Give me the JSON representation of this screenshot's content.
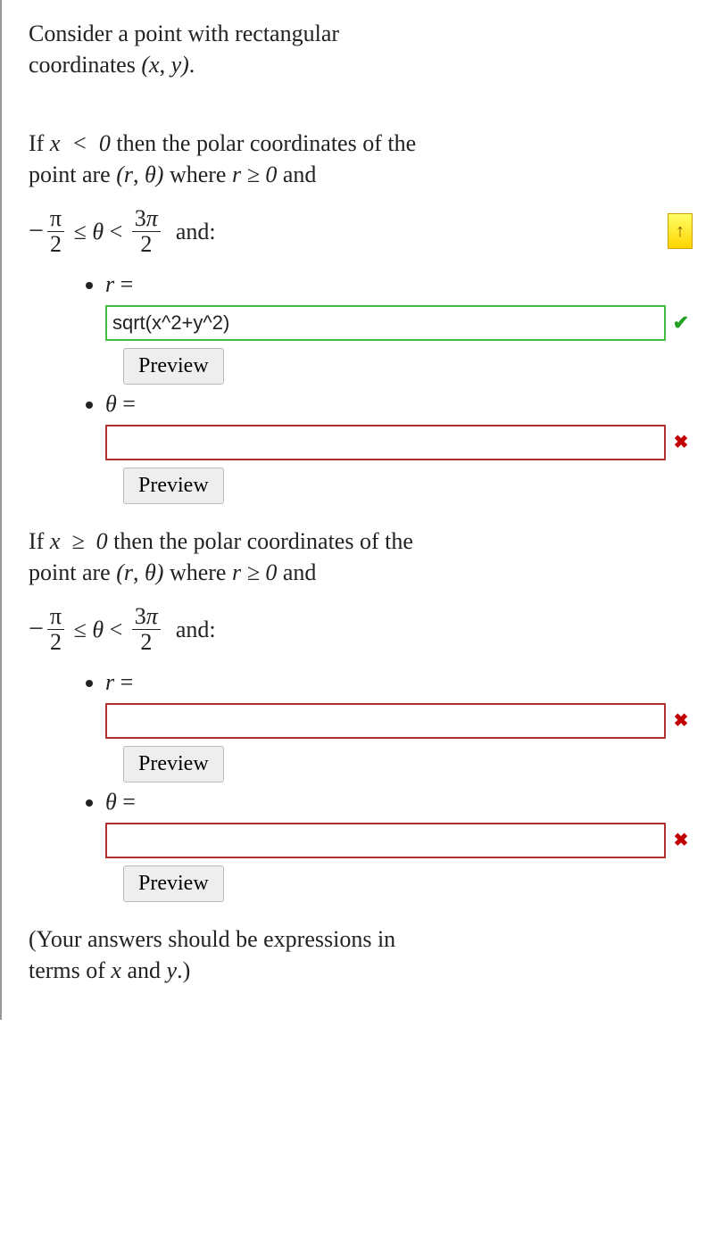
{
  "problem": {
    "intro_line1": "Consider a point with rectangular",
    "intro_line2_prefix": "coordinates ",
    "intro_line2_math": "(x, y)",
    "intro_line2_suffix": ".",
    "case_a": {
      "line1_prefix": "If ",
      "line1_cond_var": "x",
      "line1_cond_op": "<",
      "line1_cond_rhs": "0",
      "line1_mid": " then the polar coordinates of the",
      "line2_prefix": "point are ",
      "line2_rtheta": "(r, θ)",
      "line2_mid": " where ",
      "line2_r": "r",
      "line2_ge": "≥",
      "line2_zero": "0",
      "line2_and": " and",
      "range_minus": "−",
      "range_pi": "π",
      "range_two": "2",
      "range_le": "≤",
      "range_theta": "θ",
      "range_lt": "<",
      "range_3pi": "3π",
      "range_two_b": "2",
      "range_and": "and:"
    },
    "case_b": {
      "line1_prefix": "If ",
      "line1_cond_var": "x",
      "line1_cond_op": "≥",
      "line1_cond_rhs": "0",
      "line1_mid": " then the polar coordinates of the",
      "line2_prefix": "point are ",
      "line2_rtheta": "(r, θ)",
      "line2_mid": " where ",
      "line2_r": "r",
      "line2_ge": "≥",
      "line2_zero": "0",
      "line2_and": " and",
      "range_minus": "−",
      "range_pi": "π",
      "range_two": "2",
      "range_le": "≤",
      "range_theta": "θ",
      "range_lt": "<",
      "range_3pi": "3π",
      "range_two_b": "2",
      "range_and": "and:"
    },
    "answers": {
      "a_r_label_var": "r",
      "a_r_label_eq": "=",
      "a_r_value": "sqrt(x^2+y^2)",
      "a_r_status": "correct",
      "a_theta_label_var": "θ",
      "a_theta_label_eq": "=",
      "a_theta_value": "",
      "a_theta_status": "incorrect",
      "b_r_label_var": "r",
      "b_r_label_eq": "=",
      "b_r_value": "",
      "b_r_status": "incorrect",
      "b_theta_label_var": "θ",
      "b_theta_label_eq": "=",
      "b_theta_value": "",
      "b_theta_status": "incorrect",
      "preview_label": "Preview"
    },
    "footnote_line1": "(Your answers should be expressions in",
    "footnote_line2_prefix": "terms of ",
    "footnote_x": "x",
    "footnote_and": " and ",
    "footnote_y": "y",
    "footnote_suffix": ".)"
  },
  "ui": {
    "scroll_top_arrow": "↑"
  }
}
